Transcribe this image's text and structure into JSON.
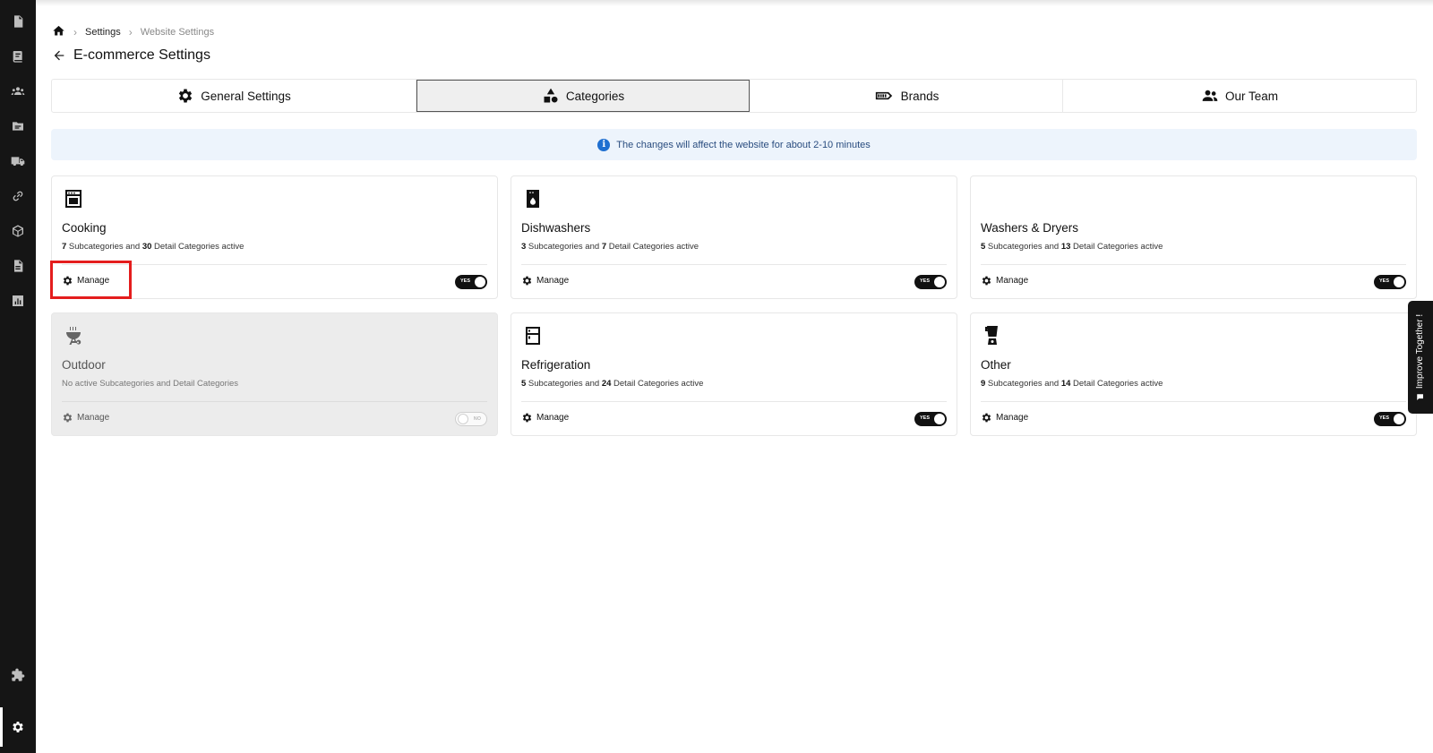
{
  "breadcrumb": {
    "items": [
      "Settings",
      "Website Settings"
    ]
  },
  "page": {
    "title": "E-commerce Settings"
  },
  "tabs": [
    {
      "label": "General Settings",
      "icon": "gear-icon"
    },
    {
      "label": "Categories",
      "icon": "shapes-icon",
      "active": true
    },
    {
      "label": "Brands",
      "icon": "brand-tag-icon"
    },
    {
      "label": "Our Team",
      "icon": "people-icon"
    }
  ],
  "banner": {
    "text": "The changes will affect the website for about 2-10 minutes",
    "color": "#edf4fc"
  },
  "cards": [
    {
      "name": "Cooking",
      "icon": "oven-icon",
      "sub": "7",
      "detail": "30",
      "text_a": " Subcategories and ",
      "text_b": " Detail Categories active",
      "manage": "Manage",
      "toggle": "YES",
      "enabled": true
    },
    {
      "name": "Dishwashers",
      "icon": "dishwasher-icon",
      "sub": "3",
      "detail": "7",
      "text_a": " Subcategories and ",
      "text_b": " Detail Categories active",
      "manage": "Manage",
      "toggle": "YES",
      "enabled": true
    },
    {
      "name": "Washers & Dryers",
      "icon": "",
      "sub": "5",
      "detail": "13",
      "text_a": " Subcategories and ",
      "text_b": " Detail Categories active",
      "manage": "Manage",
      "toggle": "YES",
      "enabled": true
    },
    {
      "name": "Outdoor",
      "icon": "grill-icon",
      "desc": "No active Subcategories and Detail Categories",
      "manage": "Manage",
      "toggle": "NO",
      "enabled": false
    },
    {
      "name": "Refrigeration",
      "icon": "fridge-icon",
      "sub": "5",
      "detail": "24",
      "text_a": " Subcategories and ",
      "text_b": " Detail Categories active",
      "manage": "Manage",
      "toggle": "YES",
      "enabled": true
    },
    {
      "name": "Other",
      "icon": "blender-icon",
      "sub": "9",
      "detail": "14",
      "text_a": " Subcategories and ",
      "text_b": " Detail Categories active",
      "manage": "Manage",
      "toggle": "YES",
      "enabled": true
    }
  ],
  "feedback": {
    "label": "Improve Together !"
  },
  "colors": {
    "sidebar": "#151515",
    "highlight": "#e41d1d",
    "info_icon": "#1f6fd0"
  }
}
